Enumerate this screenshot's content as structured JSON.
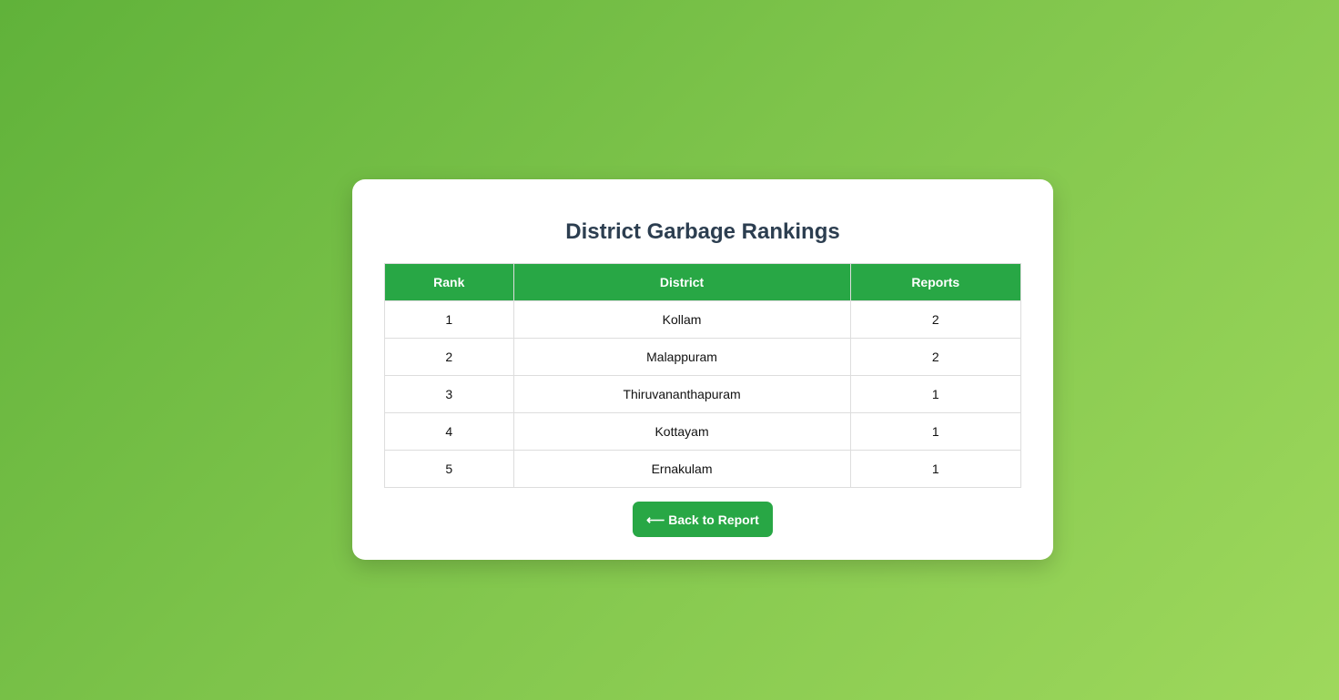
{
  "page": {
    "title": "District Garbage Rankings"
  },
  "table": {
    "headers": [
      "Rank",
      "District",
      "Reports"
    ],
    "rows": [
      {
        "rank": "1",
        "district": "Kollam",
        "reports": "2"
      },
      {
        "rank": "2",
        "district": "Malappuram",
        "reports": "2"
      },
      {
        "rank": "3",
        "district": "Thiruvananthapuram",
        "reports": "1"
      },
      {
        "rank": "4",
        "district": "Kottayam",
        "reports": "1"
      },
      {
        "rank": "5",
        "district": "Ernakulam",
        "reports": "1"
      }
    ]
  },
  "back_button": {
    "icon": "arrow-left-icon",
    "glyph": "⟵",
    "label": "Back to Report"
  },
  "colors": {
    "accent": "#28a745",
    "title": "#2c3e50"
  }
}
